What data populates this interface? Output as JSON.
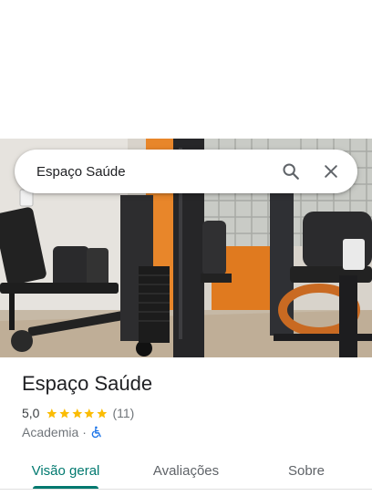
{
  "search": {
    "query": "Espaço Saúde"
  },
  "icons": {
    "search": "search-icon",
    "close": "close-icon",
    "star": "star-icon",
    "accessibility": "wheelchair-icon"
  },
  "colors": {
    "accent": "#01796f",
    "star": "#fbbc04",
    "accessibility": "#1a73e8"
  },
  "place": {
    "name": "Espaço Saúde",
    "rating": "5,0",
    "stars": 5,
    "review_count": "(11)",
    "category": "Academia",
    "separator": "·"
  },
  "tabs": [
    {
      "label": "Visão geral",
      "active": true
    },
    {
      "label": "Avaliações",
      "active": false
    },
    {
      "label": "Sobre",
      "active": false
    }
  ]
}
